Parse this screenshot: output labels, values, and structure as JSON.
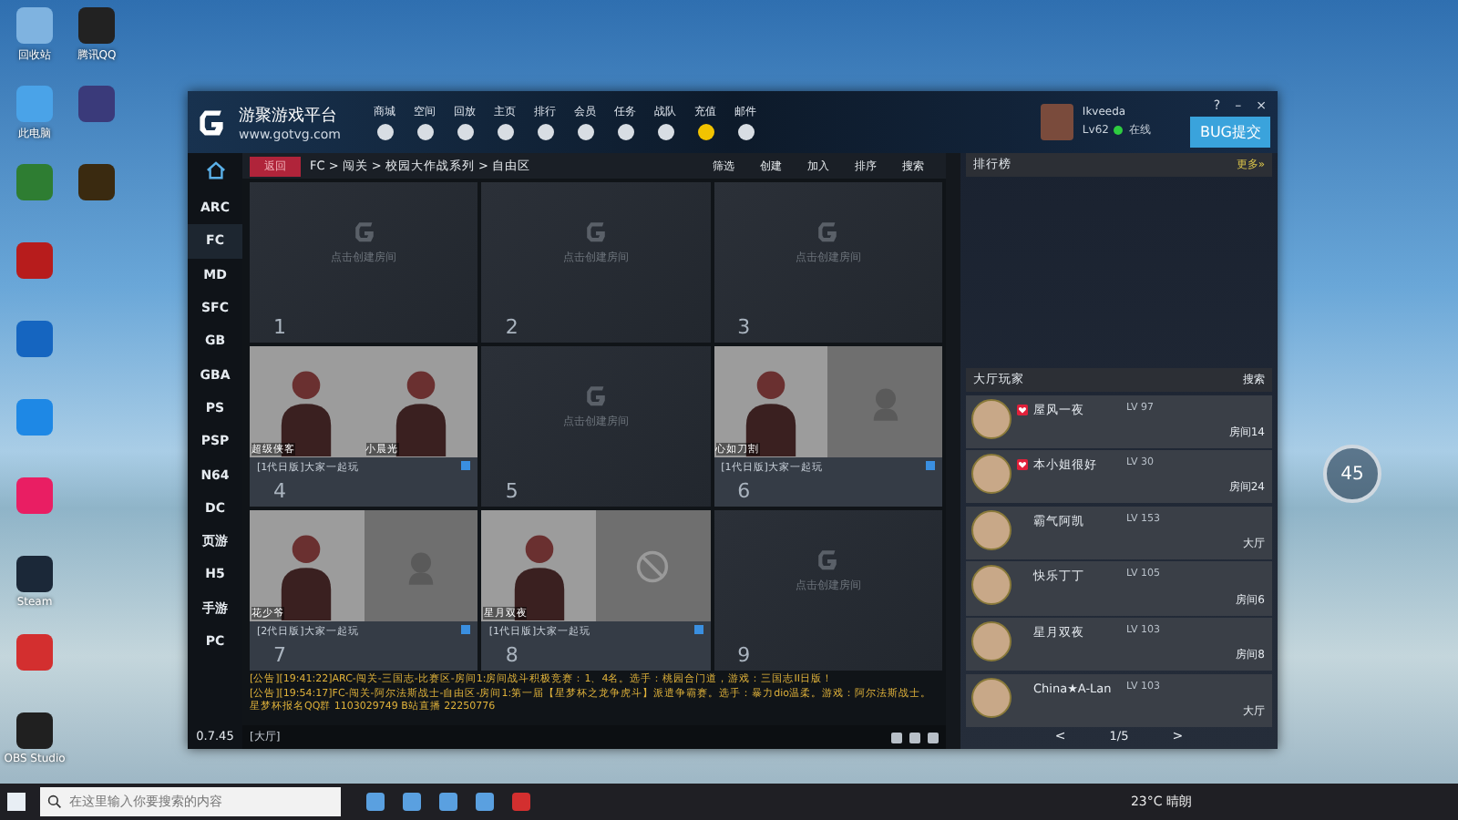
{
  "desktop": {
    "icons": [
      {
        "label": "回收站",
        "color": "#7fb3e0"
      },
      {
        "label": "腾讯QQ",
        "color": "#222222"
      },
      {
        "label": "此电脑",
        "color": "#4aa3e8"
      },
      {
        "color": "#3a3a7a"
      },
      {
        "color": "#2e7d32"
      },
      {
        "color": "#3a2a10"
      },
      {
        "color": "#b71c1c"
      },
      {
        "color": "#1565c0"
      },
      {
        "color": "#1e88e5"
      },
      {
        "color": "#e91e63"
      },
      {
        "label": "Steam",
        "color": "#1b2838"
      },
      {
        "color": "#d32f2f"
      },
      {
        "label": "OBS Studio",
        "color": "#202020"
      }
    ]
  },
  "window": {
    "title": "游聚游戏平台",
    "url": "www.gotvg.com",
    "nav": [
      "商城",
      "空间",
      "回放",
      "主页",
      "排行",
      "会员",
      "任务",
      "战队",
      "充值",
      "邮件"
    ],
    "user": {
      "name": "Ikveeda",
      "level": "Lv62",
      "status": "在线",
      "online": true
    },
    "bug_button": "BUG提交",
    "controls": [
      "?",
      "–",
      "×"
    ]
  },
  "toolbar": {
    "back": "返回",
    "breadcrumb": "FC > 闯关 > 校园大作战系列 > 自由区",
    "actions": [
      "筛选",
      "创建",
      "加入",
      "排序",
      "搜索"
    ]
  },
  "sidebar": {
    "items": [
      {
        "label": "ARC",
        "selected": false
      },
      {
        "label": "FC",
        "selected": true
      },
      {
        "label": "MD",
        "selected": false
      },
      {
        "label": "SFC",
        "selected": false
      },
      {
        "label": "GB",
        "selected": false
      },
      {
        "label": "GBA",
        "selected": false
      },
      {
        "label": "PS",
        "selected": false
      },
      {
        "label": "PSP",
        "selected": false
      },
      {
        "label": "N64",
        "selected": false
      },
      {
        "label": "DC",
        "selected": false
      },
      {
        "label": "页游",
        "selected": false
      },
      {
        "label": "H5",
        "selected": false
      },
      {
        "label": "手游",
        "selected": false
      },
      {
        "label": "PC",
        "selected": false
      }
    ]
  },
  "rooms": [
    {
      "number": "1",
      "kind": "empty",
      "hint": "点击创建房间"
    },
    {
      "number": "2",
      "kind": "empty",
      "hint": "点击创建房间"
    },
    {
      "number": "3",
      "kind": "empty",
      "hint": "点击创建房间"
    },
    {
      "number": "4",
      "kind": "occupied",
      "title": "[1代日版]大家一起玩",
      "slots": [
        {
          "kind": "player",
          "name": "超级侠客"
        },
        {
          "kind": "player",
          "name": "小晨光"
        }
      ]
    },
    {
      "number": "5",
      "kind": "empty",
      "hint": "点击创建房间"
    },
    {
      "number": "6",
      "kind": "occupied",
      "title": "[1代日版]大家一起玩",
      "slots": [
        {
          "kind": "player",
          "name": "心如刀割"
        },
        {
          "kind": "open"
        }
      ]
    },
    {
      "number": "7",
      "kind": "occupied",
      "title": "[2代日版]大家一起玩",
      "slots": [
        {
          "kind": "player",
          "name": "花少爷"
        },
        {
          "kind": "open"
        }
      ]
    },
    {
      "number": "8",
      "kind": "occupied",
      "title": "[1代日版]大家一起玩",
      "slots": [
        {
          "kind": "player",
          "name": "星月双夜"
        },
        {
          "kind": "locked"
        }
      ]
    },
    {
      "number": "9",
      "kind": "empty",
      "hint": "点击创建房间"
    }
  ],
  "chat": {
    "messages": [
      "[公告][19:41:22]ARC-闯关-三国志-比赛区-房间1:房间战斗积极竞赛：1、4名。选手：桃园合门道，游戏：三国志II日版！",
      "[公告][19:54:17]FC-闯关-阿尔法斯战士-自由区-房间1:第一届【星梦杯之龙争虎斗】派遣争霸赛。选手：暴力dio温柔。游戏：阿尔法斯战士。星梦杯报名QQ群 1103029749 B站直播 22250776"
    ],
    "version": "0.7.45",
    "channel": "[大厅]"
  },
  "ranking": {
    "title": "排行榜",
    "more": "更多»"
  },
  "lobby": {
    "title": "大厅玩家",
    "search": "搜索",
    "players": [
      {
        "name": "屋风一夜",
        "level": "LV 97",
        "location": "房间14",
        "vip": true
      },
      {
        "name": "本小姐很好",
        "level": "LV 30",
        "location": "房间24",
        "vip": true
      },
      {
        "name": "霸气阿凯",
        "level": "LV 153",
        "location": "大厅",
        "vip": false
      },
      {
        "name": "快乐丁丁",
        "level": "LV 105",
        "location": "房间6",
        "vip": false
      },
      {
        "name": "星月双夜",
        "level": "LV 103",
        "location": "房间8",
        "vip": false
      },
      {
        "name": "China★A-Lan",
        "level": "LV 103",
        "location": "大厅",
        "vip": false
      }
    ],
    "prev": "<",
    "page": "1/5",
    "next": ">"
  },
  "widget": {
    "value": "45"
  },
  "taskbar": {
    "search_placeholder": "在这里输入你要搜索的内容",
    "weather": "23°C 晴朗"
  }
}
